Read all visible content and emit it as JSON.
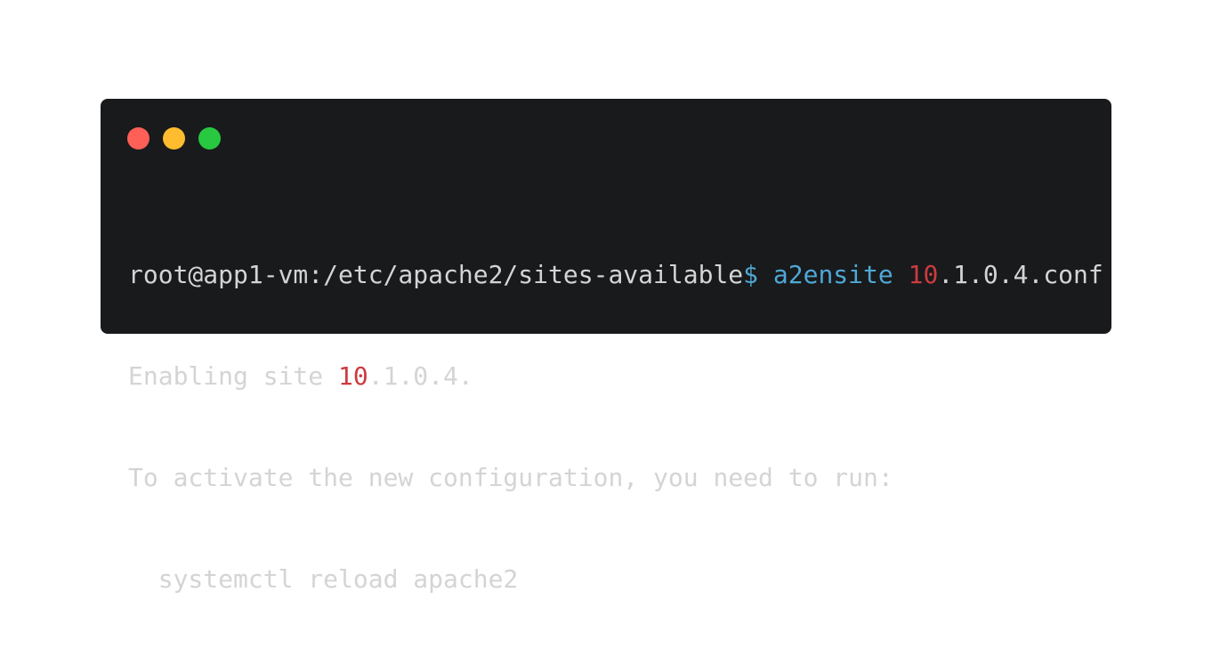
{
  "window": {
    "controls": [
      {
        "name": "close",
        "color": "#fe5f57"
      },
      {
        "name": "minimize",
        "color": "#febc2e"
      },
      {
        "name": "maximize",
        "color": "#28c840"
      }
    ]
  },
  "terminal": {
    "line1": {
      "prompt": "root@app1-vm:/etc/apache2/sites-available",
      "symbol": "$",
      "command": " a2ensite ",
      "arg_num": "10",
      "arg_rest": ".1.0.4.conf"
    },
    "line2": {
      "prefix": "Enabling site ",
      "num": "10",
      "rest": ".1.0.4."
    },
    "line3": "To activate the new configuration, you need to run:",
    "line4": "  systemctl reload apache2"
  },
  "colors": {
    "background": "#191a1c",
    "text": "#d4d4d4",
    "command": "#4fa8d6",
    "number": "#cc3b3f"
  }
}
